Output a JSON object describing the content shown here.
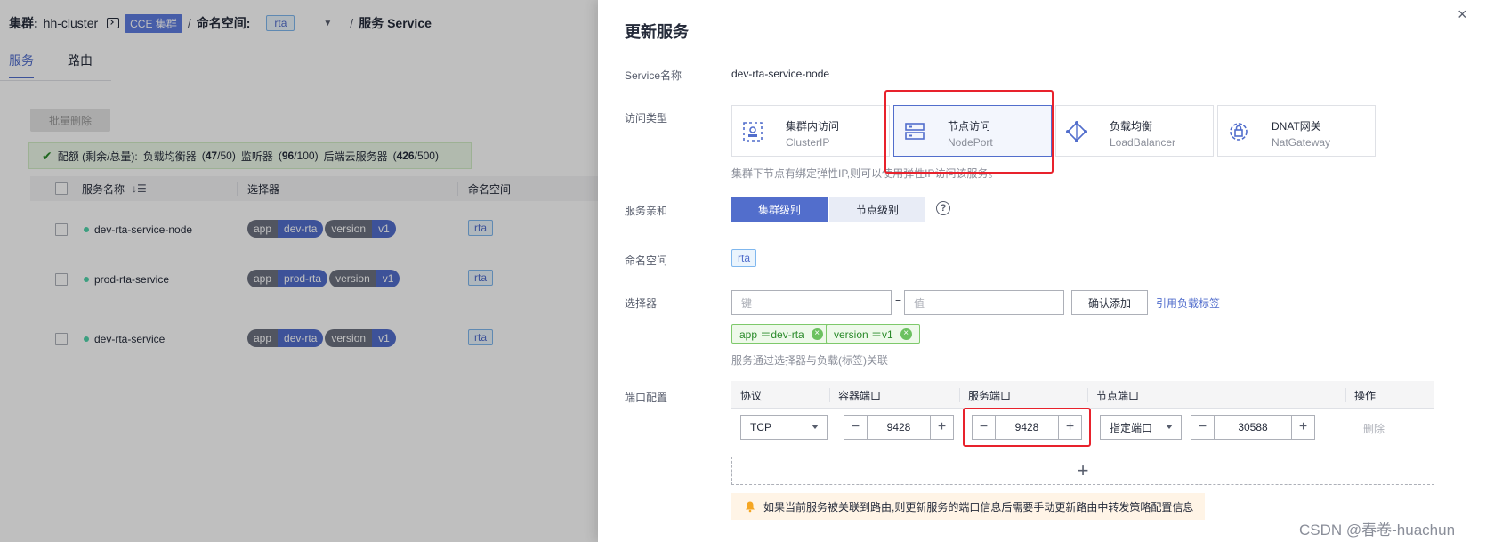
{
  "background": {
    "breadcrumb": {
      "cluster_label": "集群:",
      "cluster_name": "hh-cluster",
      "cluster_tag": "CCE 集群",
      "slash1": "/",
      "namespace_label": "命名空间:",
      "namespace_value": "rta",
      "slash2": "/",
      "page": "服务 Service"
    },
    "tabs": [
      {
        "label": "服务",
        "active": true
      },
      {
        "label": "路由",
        "active": false
      }
    ],
    "batch_delete": "批量删除",
    "quota": {
      "prefix": "配额 (剩余/总量):",
      "lb_label": "负载均衡器",
      "lb_value": "47",
      "lb_total": "50",
      "listener_label": "监听器",
      "listener_value": "96",
      "listener_total": "100",
      "backend_label": "后端云服务器",
      "backend_value": "426",
      "backend_total": "500"
    },
    "table": {
      "headers": {
        "name": "服务名称",
        "selector": "选择器",
        "namespace": "命名空间"
      },
      "sort_icon": "↓☰",
      "rows": [
        {
          "name": "dev-rta-service-node",
          "tags": [
            {
              "k": "app",
              "v": "dev-rta"
            },
            {
              "k": "version",
              "v": "v1"
            }
          ],
          "ns": "rta"
        },
        {
          "name": "prod-rta-service",
          "tags": [
            {
              "k": "app",
              "v": "prod-rta"
            },
            {
              "k": "version",
              "v": "v1"
            }
          ],
          "ns": "rta"
        },
        {
          "name": "dev-rta-service",
          "tags": [
            {
              "k": "app",
              "v": "dev-rta"
            },
            {
              "k": "version",
              "v": "v1"
            }
          ],
          "ns": "rta"
        }
      ]
    }
  },
  "drawer": {
    "title": "更新服务",
    "close": "×",
    "service_name_label": "Service名称",
    "service_name_value": "dev-rta-service-node",
    "access_type_label": "访问类型",
    "access_types": [
      {
        "title": "集群内访问",
        "sub": "ClusterIP",
        "icon": "cluster-ip-icon"
      },
      {
        "title": "节点访问",
        "sub": "NodePort",
        "icon": "node-port-icon",
        "selected": true
      },
      {
        "title": "负载均衡",
        "sub": "LoadBalancer",
        "icon": "load-balancer-icon"
      },
      {
        "title": "DNAT网关",
        "sub": "NatGateway",
        "icon": "nat-gateway-icon"
      }
    ],
    "access_hint": "集群下节点有绑定弹性IP,则可以使用弹性IP访问该服务。",
    "affinity_label": "服务亲和",
    "affinity_options": [
      {
        "label": "集群级别",
        "selected": true
      },
      {
        "label": "节点级别",
        "selected": false
      }
    ],
    "help_glyph": "?",
    "namespace_label": "命名空间",
    "namespace_value": "rta",
    "selector_label": "选择器",
    "key_placeholder": "键",
    "equals": "=",
    "value_placeholder": "值",
    "confirm_add": "确认添加",
    "reference_link": "引用负载标签",
    "selector_tags": [
      "app ＝dev-rta",
      "version ＝v1"
    ],
    "selector_hint": "服务通过选择器与负载(标签)关联",
    "port_label": "端口配置",
    "port_headers": [
      "协议",
      "容器端口",
      "服务端口",
      "节点端口",
      "操作"
    ],
    "port_row": {
      "protocol": "TCP",
      "container_port": "9428",
      "service_port": "9428",
      "node_port_mode": "指定端口",
      "node_port": "30588",
      "delete": "删除"
    },
    "add_glyph": "+",
    "warning": "如果当前服务被关联到路由,则更新服务的端口信息后需要手动更新路由中转发策略配置信息"
  },
  "watermark": "CSDN @春卷-huachun",
  "colors": {
    "accent": "#526ecc",
    "highlight": "#e8222c",
    "success": "#50d4ab"
  }
}
